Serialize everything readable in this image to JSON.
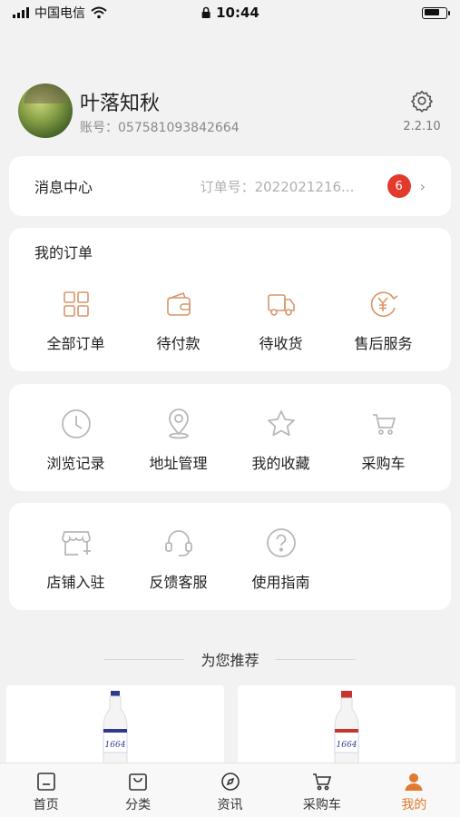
{
  "status_bar": {
    "carrier": "中国电信",
    "time": "10:44"
  },
  "profile": {
    "name": "叶落知秋",
    "account": "账号：057581093842664",
    "version": "2.2.10"
  },
  "message_center": {
    "title": "消息中心",
    "preview": "订单号：2022021216...",
    "badge_count": "6"
  },
  "orders": {
    "title": "我的订单",
    "items": [
      {
        "label": "全部订单",
        "icon": "grid-icon"
      },
      {
        "label": "待付款",
        "icon": "wallet-icon"
      },
      {
        "label": "待收货",
        "icon": "truck-icon"
      },
      {
        "label": "售后服务",
        "icon": "yen-refresh-icon"
      }
    ]
  },
  "tools": {
    "items": [
      {
        "label": "浏览记录",
        "icon": "clock-icon"
      },
      {
        "label": "地址管理",
        "icon": "location-pin-icon"
      },
      {
        "label": "我的收藏",
        "icon": "star-icon"
      },
      {
        "label": "采购车",
        "icon": "cart-icon"
      }
    ]
  },
  "services": {
    "items": [
      {
        "label": "店铺入驻",
        "icon": "store-add-icon"
      },
      {
        "label": "反馈客服",
        "icon": "headset-icon"
      },
      {
        "label": "使用指南",
        "icon": "help-circle-icon"
      }
    ]
  },
  "recommend": {
    "title": "为您推荐"
  },
  "tabbar": {
    "items": [
      {
        "label": "首页",
        "icon": "home-icon"
      },
      {
        "label": "分类",
        "icon": "bag-icon"
      },
      {
        "label": "资讯",
        "icon": "compass-icon"
      },
      {
        "label": "采购车",
        "icon": "cart-icon"
      },
      {
        "label": "我的",
        "icon": "user-icon",
        "active": true
      }
    ]
  },
  "colors": {
    "accent": "#e07a2f",
    "icon_tint": "#d9956a",
    "badge": "#e23b2c",
    "tool_icon": "#b8b8b8"
  }
}
